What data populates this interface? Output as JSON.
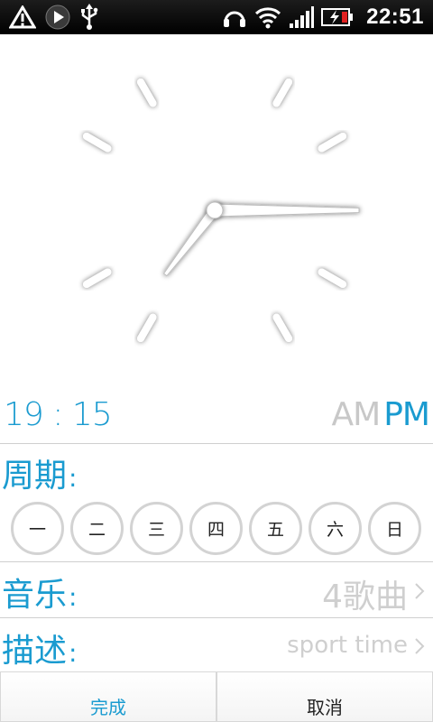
{
  "status_bar": {
    "time": "22:51",
    "icons": [
      "warning-icon",
      "play-icon",
      "usb-icon",
      "headset-icon",
      "wifi-icon",
      "signal-icon",
      "battery-charging-icon"
    ]
  },
  "clock": {
    "hour": 7,
    "minute": 15
  },
  "time_display": {
    "value": "19 : 15",
    "am_label": "AM",
    "pm_label": "PM",
    "selected": "PM"
  },
  "repeat": {
    "label": "周期",
    "colon": ":",
    "days": [
      "一",
      "二",
      "三",
      "四",
      "五",
      "六",
      "日"
    ]
  },
  "music": {
    "label": "音乐",
    "colon": ":",
    "value": "4歌曲"
  },
  "description": {
    "label": "描述",
    "colon": ":",
    "value": "sport time"
  },
  "buttons": {
    "done": "完成",
    "cancel": "取消"
  },
  "colors": {
    "accent": "#1a9bd0",
    "muted": "#c8c8c8"
  }
}
